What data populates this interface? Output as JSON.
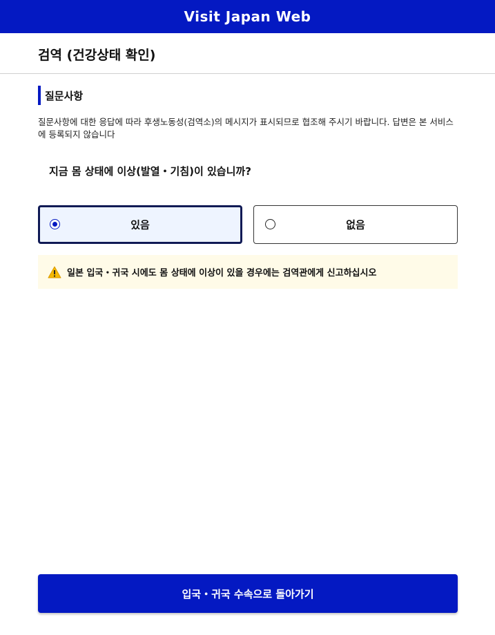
{
  "app": {
    "title": "Visit Japan Web"
  },
  "header": {
    "title": "검역 (건강상태 확인)"
  },
  "section": {
    "heading": "질문사항",
    "notice": "질문사항에 대한 응답에 따라 후생노동성(검역소)의 메시지가 표시되므로 협조해 주시기 바랍니다. 답변은 본 서비스에 등록되지 않습니다"
  },
  "question": {
    "text": "지금 몸 상태에 이상(발열・기침)이 있습니까?",
    "options": [
      {
        "label": "있음",
        "selected": true
      },
      {
        "label": "없음",
        "selected": false
      }
    ]
  },
  "warning": {
    "icon": "warning-icon",
    "text": "일본 입국・귀국 시에도 몸 상태에 이상이 있을 경우에는 검역관에게 신고하십시오"
  },
  "footer": {
    "back_label": "입국・귀국 수속으로 돌아가기"
  },
  "colors": {
    "brand": "#0419c2",
    "selected_border": "#101a55",
    "selected_bg": "#eef4ff",
    "warning_bg": "#fffbe8",
    "warning_icon": "#f5b800"
  }
}
